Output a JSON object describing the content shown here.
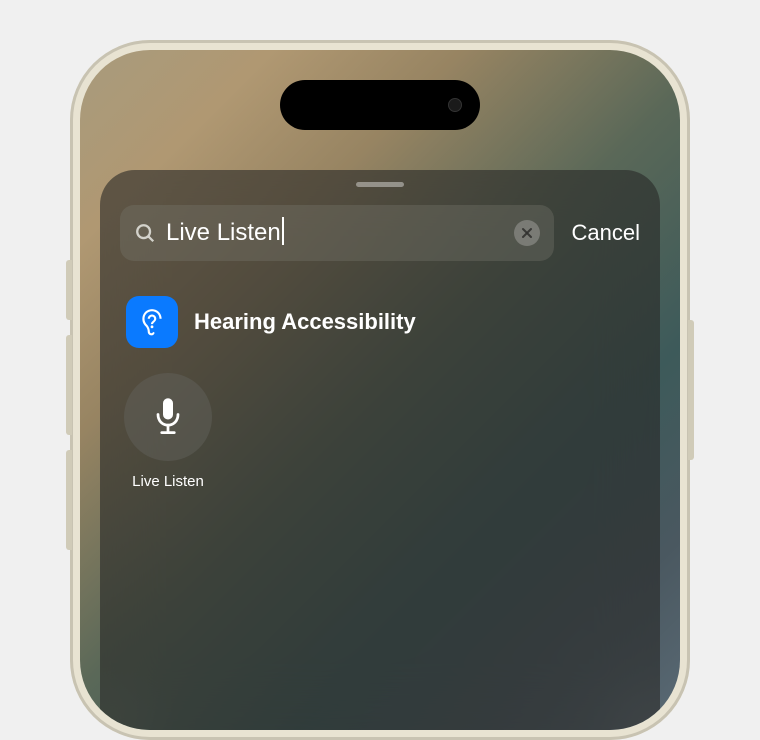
{
  "search": {
    "value": "Live Listen",
    "cancel_label": "Cancel"
  },
  "category": {
    "label": "Hearing Accessibility"
  },
  "tile": {
    "label": "Live Listen"
  }
}
